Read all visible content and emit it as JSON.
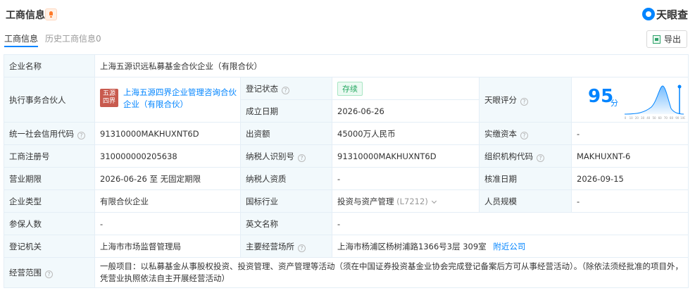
{
  "header": {
    "title": "工商信息",
    "logo_text": "天眼查"
  },
  "tabs": [
    {
      "label": "工商信息",
      "active": true
    },
    {
      "label": "历史工商信息0",
      "active": false
    }
  ],
  "toolbar": {
    "export_label": "导出"
  },
  "colors": {
    "accent": "#0084ff",
    "status_green": "#26a861",
    "label_bg": "#f2f9fc"
  },
  "rows": {
    "company_name": {
      "label": "企业名称",
      "value": "上海五源识远私募基金合伙企业（有限合伙）"
    },
    "partner": {
      "label": "执行事务合伙人",
      "logo_text": "五源四界",
      "value": "上海五源四界企业管理咨询合伙企业（有限合伙）"
    },
    "reg_status": {
      "label": "登记状态",
      "value": "存续"
    },
    "found_date": {
      "label": "成立日期",
      "value": "2026-06-26"
    },
    "score": {
      "label": "天眼评分",
      "value": "95",
      "unit": "分",
      "axis_ticks": [
        "0",
        "10",
        "20",
        "30",
        "40",
        "50",
        "60",
        "70",
        "80",
        "90",
        "100"
      ]
    },
    "credit_code": {
      "label": "统一社会信用代码",
      "value": "91310000MAKHUXNT6D"
    },
    "capital": {
      "label": "出资额",
      "value": "45000万人民币"
    },
    "paid_capital": {
      "label": "实缴资本",
      "value": "-"
    },
    "reg_no": {
      "label": "工商注册号",
      "value": "310000000205638"
    },
    "taxpayer_id": {
      "label": "纳税人识别号",
      "value": "91310000MAKHUXNT6D"
    },
    "org_code": {
      "label": "组织机构代码",
      "value": "MAKHUXNT-6"
    },
    "term": {
      "label": "营业期限",
      "value": "2026-06-26 至 无固定期限"
    },
    "taxpayer_qual": {
      "label": "纳税人资质",
      "value": "-"
    },
    "approve_date": {
      "label": "核准日期",
      "value": "2026-09-15"
    },
    "company_type": {
      "label": "企业类型",
      "value": "有限合伙企业"
    },
    "industry": {
      "label": "国标行业",
      "value": "投资与资产管理",
      "code": "(L7212)"
    },
    "staff_size": {
      "label": "人员规模",
      "value": "-"
    },
    "insured": {
      "label": "参保人数",
      "value": "-"
    },
    "english_name": {
      "label": "英文名称",
      "value": "-"
    },
    "authority": {
      "label": "登记机关",
      "value": "上海市市场监督管理局"
    },
    "address": {
      "label": "主要经营场所",
      "value": "上海市杨浦区杨树浦路1366号3层 309室",
      "link": "附近公司"
    },
    "scope": {
      "label": "经营范围",
      "value": "一般项目：以私募基金从事股权投资、投资管理、资产管理等活动（须在中国证券投资基金业协会完成登记备案后方可从事经营活动）。（除依法须经批准的项目外，凭营业执照依法自主开展经营活动）"
    }
  }
}
